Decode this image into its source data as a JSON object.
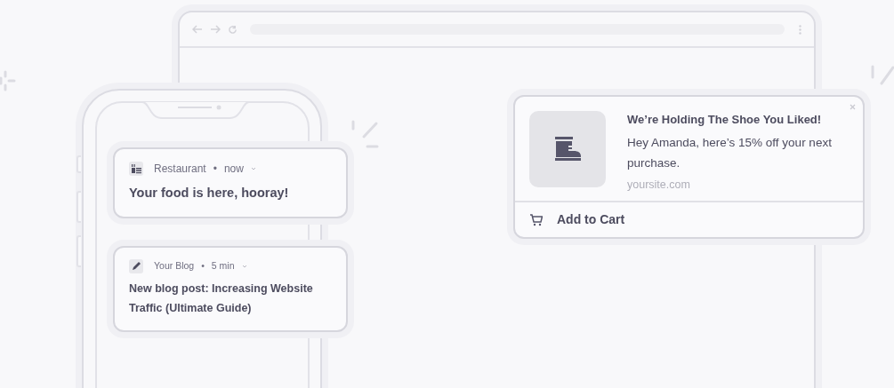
{
  "phone_notifications": [
    {
      "kind": "restaurant",
      "app": "Restaurant",
      "separator": "•",
      "time": "now",
      "message": "Your food is here, hooray!"
    },
    {
      "kind": "blog",
      "app": "Your Blog",
      "separator": "•",
      "time": "5 min",
      "message": "New blog post: Increasing Website Traffic (Ultimate Guide)"
    }
  ],
  "web_notification": {
    "title": "We’re Holding The Shoe You Liked!",
    "body": "Hey Amanda, here’s 15% off your next purchase.",
    "site": "yoursite.com",
    "action": "Add to Cart"
  }
}
